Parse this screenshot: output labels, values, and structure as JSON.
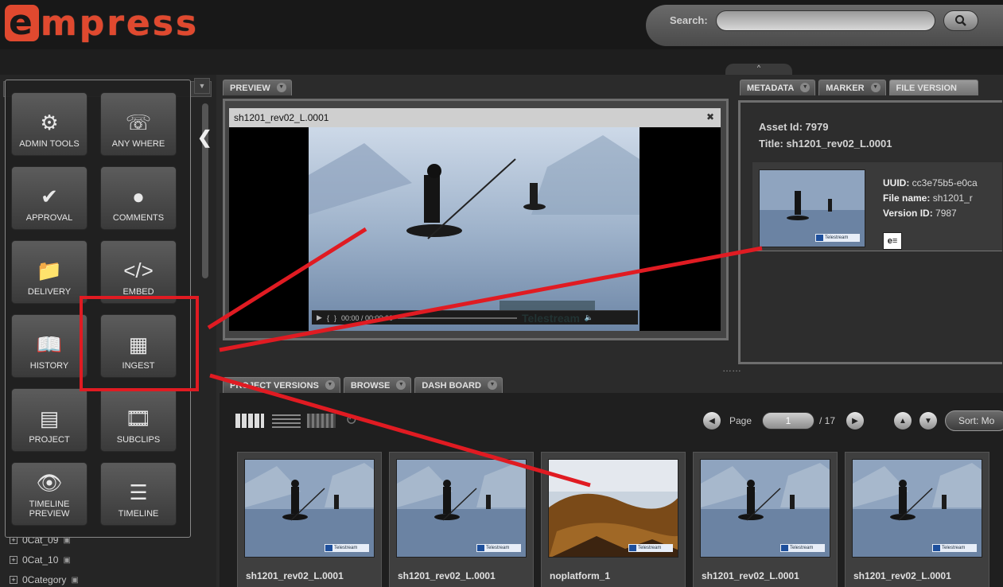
{
  "app": {
    "logo_first": "e",
    "logo_rest": "mpress"
  },
  "search": {
    "label": "Search:",
    "value": "",
    "placeholder": ""
  },
  "divider_handle": "^",
  "menu": {
    "tiles": [
      {
        "label": "ADMIN TOOLS",
        "icon": "admin-tools-icon"
      },
      {
        "label": "ANY WHERE",
        "icon": "anywhere-icon"
      },
      {
        "label": "APPROVAL",
        "icon": "checkmark-icon"
      },
      {
        "label": "COMMENTS",
        "icon": "comment-bubble-icon"
      },
      {
        "label": "DELIVERY",
        "icon": "folder-delivery-icon"
      },
      {
        "label": "EMBED",
        "icon": "code-icon"
      },
      {
        "label": "HISTORY",
        "icon": "book-icon"
      },
      {
        "label": "INGEST",
        "icon": "ingest-icon"
      },
      {
        "label": "PROJECT",
        "icon": "project-icon"
      },
      {
        "label": "SUBCLIPS",
        "icon": "film-clip-icon"
      },
      {
        "label": "TIMELINE PREVIEW",
        "icon": "eye-icon"
      },
      {
        "label": "TIMELINE",
        "icon": "timeline-lines-icon"
      }
    ]
  },
  "categories": [
    "0Cat_09",
    "0Cat_10",
    "0Category"
  ],
  "preview": {
    "tab_label": "PREVIEW",
    "video_title": "sh1201_rev02_L.0001",
    "timecode": "00:00 / 00:00:00",
    "watermark": "Telestream"
  },
  "metadata": {
    "tabs": [
      "METADATA",
      "MARKER",
      "FILE VERSION"
    ],
    "asset_id_label": "Asset Id:",
    "asset_id": "7979",
    "title_label": "Title:",
    "title": "sh1201_rev02_L.0001",
    "uuid_label": "UUID:",
    "uuid": "cc3e75b5-e0ca",
    "file_name_label": "File name:",
    "file_name": "sh1201_r",
    "version_id_label": "Version ID:",
    "version_id": "7987"
  },
  "bottom": {
    "tabs": [
      "PROJECT VERSIONS",
      "BROWSE",
      "DASH BOARD"
    ],
    "page_label": "Page",
    "page_value": "1",
    "page_total": "/ 17",
    "sort_label": "Sort: Mo",
    "thumb_badge": "Telestream",
    "cards": [
      {
        "title": "sh1201_rev02_L.0001",
        "kind": "lake"
      },
      {
        "title": "sh1201_rev02_L.0001",
        "kind": "lake"
      },
      {
        "title": "noplatform_1",
        "kind": "rocks"
      },
      {
        "title": "sh1201_rev02_L.0001",
        "kind": "lake"
      },
      {
        "title": "sh1201_rev02_L.0001",
        "kind": "lake"
      }
    ]
  },
  "colors": {
    "accent": "#e0492f",
    "annotation": "#e01b22",
    "panel_bg": "#2b2b2b"
  }
}
